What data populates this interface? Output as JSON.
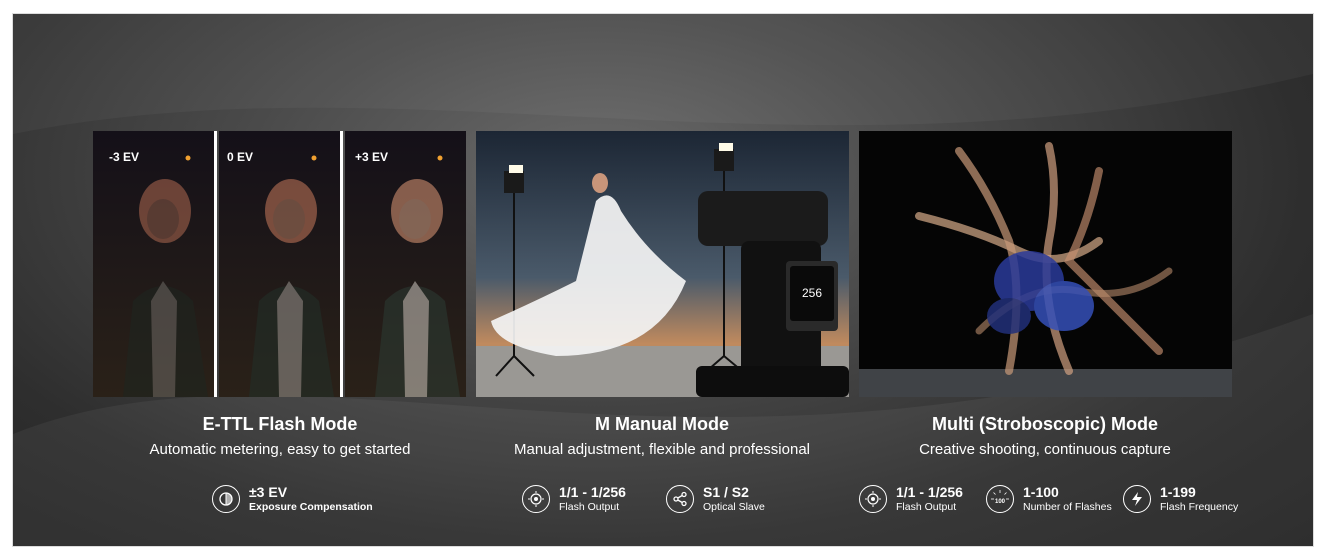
{
  "panels": [
    {
      "title": "E-TTL Flash Mode",
      "subtitle": "Automatic metering, easy to get started",
      "ev_labels": [
        "-3 EV",
        "0 EV",
        "+3 EV"
      ],
      "specs": [
        {
          "value": "±3 EV",
          "label": "Exposure Compensation",
          "icon": "exposure-compensation-icon"
        }
      ]
    },
    {
      "title": "M Manual Mode",
      "subtitle": "Manual adjustment, flexible and professional",
      "flash_screen_value": "256",
      "specs": [
        {
          "value": "1/1 - 1/256",
          "label": "Flash Output",
          "icon": "flash-output-icon"
        },
        {
          "value": "S1 / S2",
          "label": "Optical Slave",
          "icon": "share-icon"
        }
      ]
    },
    {
      "title": "Multi (Stroboscopic) Mode",
      "subtitle": "Creative shooting, continuous capture",
      "specs": [
        {
          "value": "1/1 - 1/256",
          "label": "Flash Output",
          "icon": "flash-output-icon"
        },
        {
          "value": "1-100",
          "label": "Number of Flashes",
          "icon": "flash-count-icon",
          "icon_text": "100"
        },
        {
          "value": "1-199",
          "label": "Flash Frequency",
          "icon": "lightning-icon"
        }
      ]
    }
  ],
  "colors": {
    "background": "#3a3a3a",
    "text": "#ffffff"
  }
}
